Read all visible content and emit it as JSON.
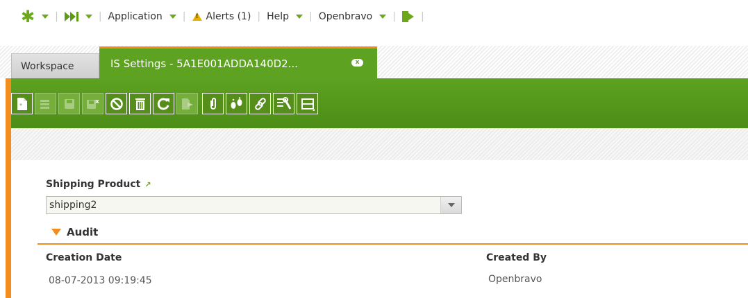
{
  "topnav": {
    "application_label": "Application",
    "alerts_label": "Alerts (1)",
    "help_label": "Help",
    "user_label": "Openbravo",
    "separator": "|"
  },
  "tabs": [
    {
      "label": "Workspace"
    },
    {
      "label": "IS Settings - 5A1E001ADDA140D2...",
      "close_glyph": "x"
    }
  ],
  "toolbar": {
    "buttons": [
      {
        "icon": "new-document-icon",
        "enabled": true
      },
      {
        "icon": "new-row-icon",
        "enabled": false
      },
      {
        "icon": "save-icon",
        "enabled": false
      },
      {
        "icon": "save-close-icon",
        "enabled": false
      },
      {
        "icon": "cancel-icon",
        "enabled": true
      },
      {
        "icon": "delete-icon",
        "enabled": true
      },
      {
        "icon": "refresh-icon",
        "enabled": true
      },
      {
        "icon": "export-icon",
        "enabled": false
      },
      {
        "icon": "attachment-icon",
        "enabled": true
      },
      {
        "icon": "audit-trail-icon",
        "enabled": true
      },
      {
        "icon": "link-icon",
        "enabled": true
      },
      {
        "icon": "tools-icon",
        "enabled": true
      },
      {
        "icon": "layout-icon",
        "enabled": true
      }
    ]
  },
  "form": {
    "shipping_product_label": "Shipping Product",
    "shipping_product_value": "shipping2",
    "link_glyph": "↗",
    "audit_section_label": "Audit",
    "creation_date_label": "Creation Date",
    "creation_date_value": "08-07-2013 09:19:45",
    "created_by_label": "Created By",
    "created_by_value": "Openbravo"
  },
  "colors": {
    "brand_green": "#5ea221",
    "accent_orange": "#f28d1f"
  }
}
